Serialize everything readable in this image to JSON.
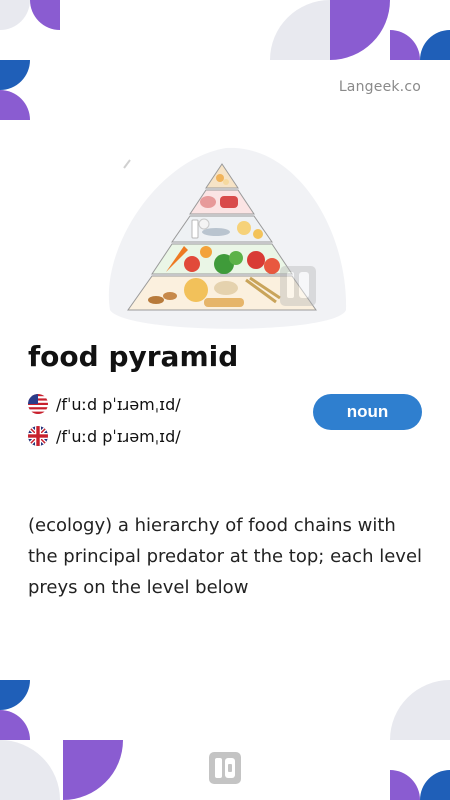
{
  "brand": {
    "label": "Langeek.co"
  },
  "entry": {
    "word": "food pyramid",
    "part_of_speech": "noun",
    "pronunciations": [
      {
        "region": "US",
        "flag_icon": "us-flag-icon",
        "ipa": "/fˈuːd pˈɪɹəmˌɪd/"
      },
      {
        "region": "UK",
        "flag_icon": "uk-flag-icon",
        "ipa": "/fˈuːd pˈɪɹəmˌɪd/"
      }
    ],
    "definition": "(ecology) a hierarchy of food chains with the principal predator at the top; each level preys on the level below"
  },
  "colors": {
    "accent_purple": "#8a5cd1",
    "accent_blue": "#1f5fb8",
    "shape_gray": "#e8e9ef",
    "badge_blue": "#2f7fcf"
  },
  "icons": {
    "illustration": "food-pyramid-illustration",
    "footer": "langeek-logo-icon"
  }
}
